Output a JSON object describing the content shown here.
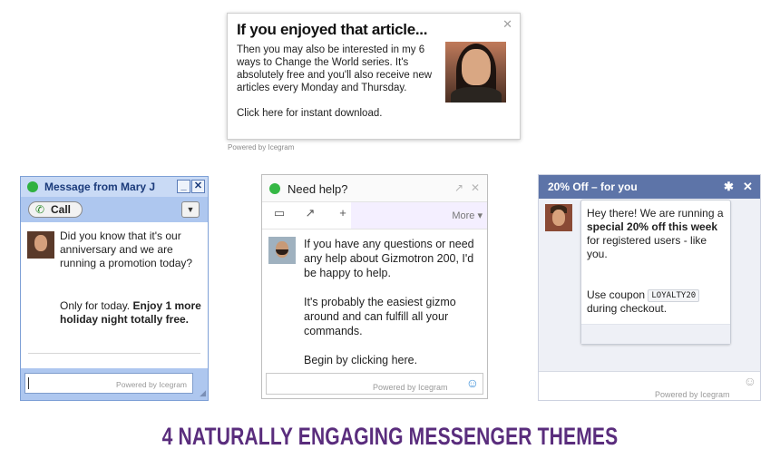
{
  "article": {
    "close_icon": "close-icon",
    "title": "If you enjoyed that article...",
    "body": "Then you may also be interested in my 6 ways to Change the World series. It's absolutely free and you'll also receive new articles every Monday and Thursday.",
    "cta": "Click here for instant download.",
    "powered_by": "Powered by Icegram"
  },
  "gtalk": {
    "title": "Message from Mary J",
    "status_color": "#2fb140",
    "minimize_label": "_",
    "close_label": "✕",
    "call_label": "Call",
    "dropdown_label": "▼",
    "message_line1": "Did you know that it's our anniversary and we are running a promotion today?",
    "message_line2_prefix": "Only for today. ",
    "message_line2_bold": "Enjoy 1 more holiday night totally free.",
    "powered_by": "Powered by Icegram"
  },
  "help": {
    "title": "Need help?",
    "status_color": "#35b845",
    "popout_label": "↗",
    "close_label": "✕",
    "more_label": "More ▾",
    "para1": "If you have any questions or need any help about Gizmotron 200, I'd be happy to help.",
    "para2": "It's probably the easiest gizmo around and can fulfill all your commands.",
    "para3": "Begin by clicking here.",
    "powered_by": "Powered by Icegram"
  },
  "fb": {
    "title": "20% Off – for you",
    "header_color": "#5d74a8",
    "gear_label": "✱",
    "close_label": "✕",
    "msg_prefix": "Hey there! We are running a ",
    "msg_bold": "special 20% off this week",
    "msg_suffix": " for registered users - like you.",
    "coupon_prefix": "Use coupon ",
    "coupon_code": "LOYALTY20",
    "coupon_suffix": " during checkout.",
    "powered_by": "Powered by Icegram"
  },
  "caption": "4 NATURALLY ENGAGING MESSENGER THEMES",
  "caption_color": "#5a2d7d"
}
